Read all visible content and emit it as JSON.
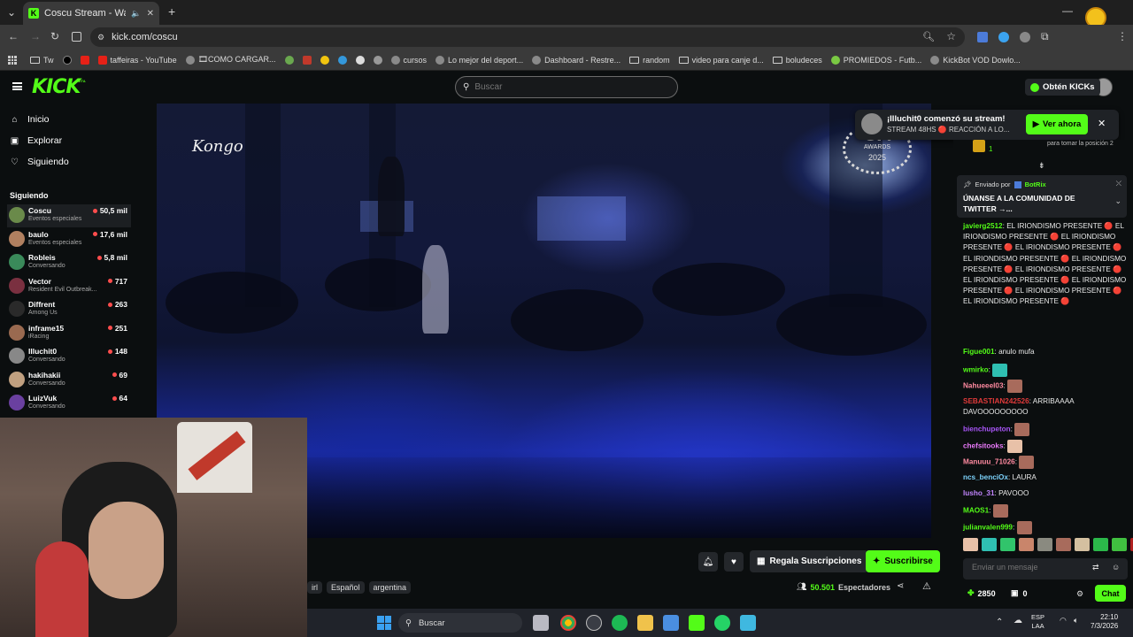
{
  "browser": {
    "tab_title": "Coscu Stream - Watch Live",
    "url": "kick.com/coscu",
    "bookmarks": [
      {
        "label": "Tw",
        "icon": "folder-icon"
      },
      {
        "label": "",
        "icon": "tiktok-icon"
      },
      {
        "label": "",
        "icon": "youtube-icon"
      },
      {
        "label": "taffeiras - YouTube",
        "icon": "youtube-icon"
      },
      {
        "label": "🎞COMO CARGAR...",
        "icon": "globe-icon"
      },
      {
        "label": "cursos",
        "icon": "globe-icon"
      },
      {
        "label": "Lo mejor del deport...",
        "icon": "globe-icon"
      },
      {
        "label": "Dashboard - Restre...",
        "icon": "globe-icon"
      },
      {
        "label": "random",
        "icon": "folder-icon"
      },
      {
        "label": "video para canje d...",
        "icon": "folder-icon"
      },
      {
        "label": "boludeces",
        "icon": "folder-icon"
      },
      {
        "label": "PROMIEDOS - Futb...",
        "icon": "promiedos-icon"
      },
      {
        "label": "KickBot VOD Dowlo...",
        "icon": "globe-icon"
      }
    ]
  },
  "kick": {
    "logo": "KICK",
    "logo_badge": "BETA",
    "search_placeholder": "Buscar",
    "get_kicks": "Obtén KICKs",
    "nav": [
      {
        "label": "Inicio",
        "icon": "home-icon"
      },
      {
        "label": "Explorar",
        "icon": "compass-icon"
      },
      {
        "label": "Siguiendo",
        "icon": "heart-icon"
      }
    ],
    "following_title": "Siguiendo",
    "following": [
      {
        "name": "Coscu",
        "category": "Eventos especiales",
        "viewers": "50,5 mil",
        "color": "#6a8a4a"
      },
      {
        "name": "baulo",
        "category": "Eventos especiales",
        "viewers": "17,6 mil",
        "color": "#b08060"
      },
      {
        "name": "Robleis",
        "category": "Conversando",
        "viewers": "5,8 mil",
        "color": "#3a8a5a"
      },
      {
        "name": "Vector",
        "category": "Resident Evil Outbreak...",
        "viewers": "717",
        "color": "#7a3040"
      },
      {
        "name": "Diffrent",
        "category": "Among Us",
        "viewers": "263",
        "color": "#2a2a2a"
      },
      {
        "name": "inframe15",
        "category": "iRacing",
        "viewers": "251",
        "color": "#9a6a50"
      },
      {
        "name": "Illuchit0",
        "category": "Conversando",
        "viewers": "148",
        "color": "#888888"
      },
      {
        "name": "hakihakii",
        "category": "Conversando",
        "viewers": "69",
        "color": "#c0a080"
      },
      {
        "name": "LuizVuk",
        "category": "Conversando",
        "viewers": "64",
        "color": "#6a40a0"
      }
    ],
    "video": {
      "watermark": "Kongo",
      "awards_line1": "CA",
      "awards_line2": "AWARDS",
      "awards_year": "2025"
    },
    "notification": {
      "title": "¡Illuchit0 comenzó su stream!",
      "subtitle": "STREAM 48HS 🔴 REACCIÓN A LO...",
      "button": "Ver ahora"
    },
    "below_video": {
      "gift_label": "Regala Suscripciones",
      "subscribe_label": "Suscribirse",
      "tags": [
        "irl",
        "Español",
        "argentina"
      ],
      "viewers": "50.501",
      "viewers_label": "Espectadores"
    },
    "chat": {
      "leaderboard_value": "1",
      "leaderboard_text": "para tomar la posición 2",
      "pinned_sent_by": "Enviado por",
      "pinned_bot": "BotRix",
      "pinned_message": "ÚNANSE A LA COMUNIDAD DE TWITTER →...",
      "messages": [
        {
          "user": "javierg2512",
          "color": "#53fc18",
          "text": "EL IRIONDISMO PRESENTE 🔴 EL IRIONDISMO PRESENTE 🔴 EL IRIONDISMO PRESENTE 🔴 EL IRIONDISMO PRESENTE 🔴 EL IRIONDISMO PRESENTE 🔴 EL IRIONDISMO PRESENTE 🔴 EL IRIONDISMO PRESENTE 🔴 EL IRIONDISMO PRESENTE 🔴 EL IRIONDISMO PRESENTE 🔴 EL IRIONDISMO PRESENTE 🔴 EL IRIONDISMO PRESENTE 🔴"
        },
        {
          "user": "Figue001",
          "color": "#53fc18",
          "text": "anulo mufa"
        },
        {
          "user": "wmirko",
          "color": "#53fc18",
          "text": ""
        },
        {
          "user": "Nahueeel03",
          "color": "#ff8aa0",
          "text": ""
        },
        {
          "user": "SEBASTIAN242526",
          "color": "#e03a3a",
          "text": "ARRIBAAAA DAVOOOOOOOOO"
        },
        {
          "user": "bienchupeton",
          "color": "#a855f7",
          "text": ""
        },
        {
          "user": "chefsitooks",
          "color": "#e879f9",
          "text": ""
        },
        {
          "user": "Manuuu_71026",
          "color": "#ff8aa0",
          "text": ""
        },
        {
          "user": "ncs_benciOx",
          "color": "#7dd3fc",
          "text": "LAURA"
        },
        {
          "user": "lusho_31",
          "color": "#c084fc",
          "text": "PAVOOO"
        },
        {
          "user": "MAOS1",
          "color": "#53fc18",
          "text": ""
        },
        {
          "user": "julianvalen999",
          "color": "#53fc18",
          "text": ""
        }
      ],
      "input_placeholder": "Enviar un mensaje",
      "points": "2850",
      "gifts": "0",
      "chat_button": "Chat"
    }
  },
  "taskbar": {
    "search": "Buscar",
    "lang_line1": "ESP",
    "lang_line2": "LAA",
    "time": "22:10",
    "date": "7/3/2026"
  },
  "colors": {
    "accent": "#53fc18",
    "bg": "#0b0e0f"
  }
}
